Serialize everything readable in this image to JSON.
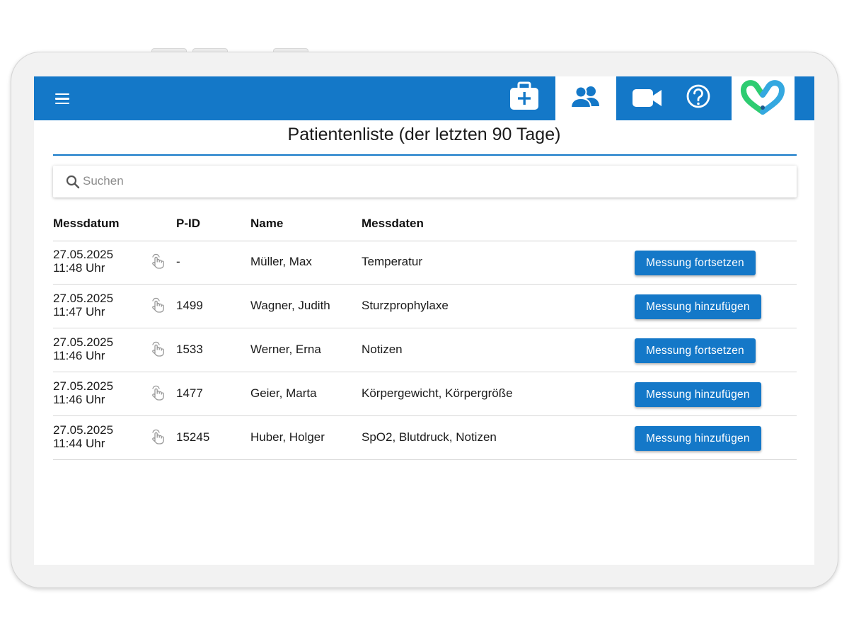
{
  "header": {
    "title": "Patientenliste (der letzten 90 Tage)"
  },
  "toolbar": {
    "icons": [
      "menu-icon",
      "medical-kit-icon",
      "patients-icon",
      "video-camera-icon",
      "help-icon",
      "app-logo"
    ],
    "active": "patients-icon",
    "accent": "#1478c8"
  },
  "search": {
    "placeholder": "Suchen",
    "value": ""
  },
  "table": {
    "columns": {
      "date": "Messdatum",
      "pid": "P-ID",
      "name": "Name",
      "measurements": "Messdaten"
    },
    "rows": [
      {
        "date": "27.05.2025",
        "time": "11:48 Uhr",
        "pid": "-",
        "name": "Müller, Max",
        "measurements": "Temperatur",
        "action": "Messung fortsetzen"
      },
      {
        "date": "27.05.2025",
        "time": "11:47 Uhr",
        "pid": "1499",
        "name": "Wagner, Judith",
        "measurements": "Sturzprophylaxe",
        "action": "Messung hinzufügen"
      },
      {
        "date": "27.05.2025",
        "time": "11:46 Uhr",
        "pid": "1533",
        "name": "Werner, Erna",
        "measurements": "Notizen",
        "action": "Messung fortsetzen"
      },
      {
        "date": "27.05.2025",
        "time": "11:46 Uhr",
        "pid": "1477",
        "name": "Geier, Marta",
        "measurements": "Körpergewicht, Körpergröße",
        "action": "Messung hinzufügen"
      },
      {
        "date": "27.05.2025",
        "time": "11:44 Uhr",
        "pid": "15245",
        "name": "Huber, Holger",
        "measurements": "SpO2, Blutdruck, Notizen",
        "action": "Messung hinzufügen"
      }
    ]
  }
}
